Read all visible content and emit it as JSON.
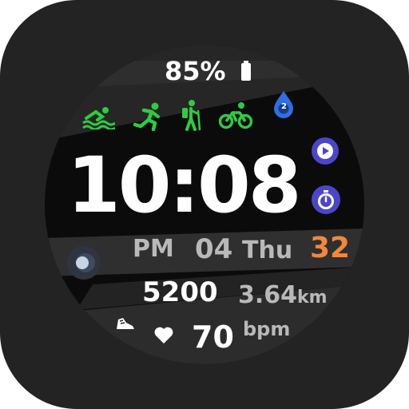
{
  "colors": {
    "tile_background": "#232323",
    "face_background": "#0b0b0b",
    "band_dark": "#2b2b2b",
    "band_mid": "#3a3a3a",
    "text_primary": "#ffffff",
    "text_secondary": "#b9b9b9",
    "activity_green": "#2ecc40",
    "accent_blue": "#2f6fe4",
    "accent_purple": "#4b46c9",
    "accent_orange": "#f3873a"
  },
  "battery": {
    "percent_text": "85%",
    "level": 0.85,
    "icon": "battery-icon"
  },
  "activities": [
    {
      "name": "swimming",
      "icon": "swim-icon"
    },
    {
      "name": "running",
      "icon": "run-icon"
    },
    {
      "name": "hiking",
      "icon": "hike-icon"
    },
    {
      "name": "cycling",
      "icon": "bike-icon"
    }
  ],
  "water": {
    "icon": "water-drop-icon",
    "count": "2"
  },
  "time": {
    "display": "10:08",
    "period": "PM"
  },
  "date": {
    "day": "04",
    "weekday": "Thu",
    "extra_value": "32"
  },
  "controls": [
    {
      "name": "play",
      "icon": "play-icon"
    },
    {
      "name": "stopwatch",
      "icon": "stopwatch-icon"
    }
  ],
  "steps": {
    "value": "5200",
    "distance": "3.64",
    "distance_unit": "km",
    "icon": "shoe-icon"
  },
  "heart": {
    "value": "70",
    "unit": "bpm",
    "icon": "heart-icon"
  },
  "side_toggle": {
    "icon": "toggle-icon"
  }
}
